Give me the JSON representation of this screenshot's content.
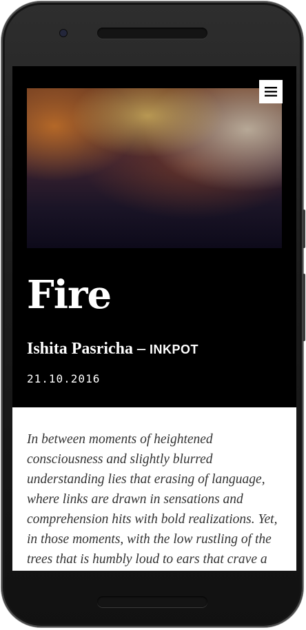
{
  "article": {
    "title": "Fire",
    "author": "Ishita Pasricha",
    "separator": "–",
    "publication": "INKPOT",
    "date": "21.10.2016",
    "excerpt": "In between moments of heightened consciousness and slightly blurred understanding lies that erasing of language, where links are drawn in sensations and comprehension hits with bold realizations. Yet, in those moments, with the low rustling of the trees that is humbly loud to ears that crave a"
  },
  "menu": {
    "icon": "hamburger-menu-icon"
  },
  "colors": {
    "header_bg": "#000000",
    "body_bg": "#ffffff",
    "text_light": "#ffffff",
    "text_dark": "#333333"
  }
}
